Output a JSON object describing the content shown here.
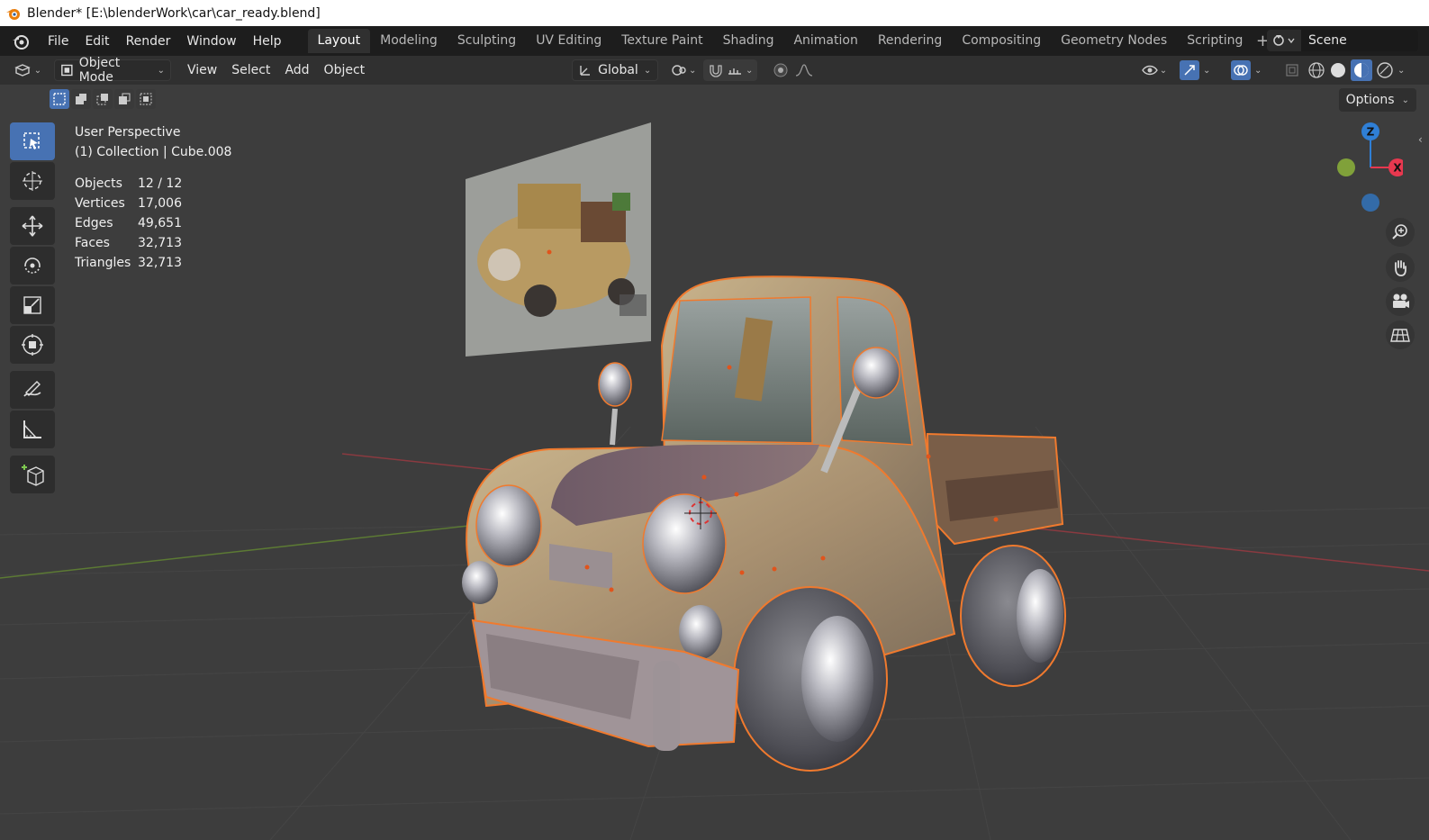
{
  "window": {
    "title": "Blender* [E:\\blenderWork\\car\\car_ready.blend]"
  },
  "menu": {
    "file": "File",
    "edit": "Edit",
    "render": "Render",
    "window": "Window",
    "help": "Help"
  },
  "workspaces": [
    "Layout",
    "Modeling",
    "Sculpting",
    "UV Editing",
    "Texture Paint",
    "Shading",
    "Animation",
    "Rendering",
    "Compositing",
    "Geometry Nodes",
    "Scripting"
  ],
  "active_workspace": "Layout",
  "scene": {
    "name": "Scene"
  },
  "header": {
    "mode": "Object Mode",
    "view": "View",
    "select": "Select",
    "add": "Add",
    "object": "Object",
    "transform_orientation": "Global",
    "options": "Options"
  },
  "viewport": {
    "perspective": "User Perspective",
    "collection": "(1) Collection | Cube.008"
  },
  "stats": [
    {
      "label": "Objects",
      "value": "12 / 12"
    },
    {
      "label": "Vertices",
      "value": "17,006"
    },
    {
      "label": "Edges",
      "value": "49,651"
    },
    {
      "label": "Faces",
      "value": "32,713"
    },
    {
      "label": "Triangles",
      "value": "32,713"
    }
  ],
  "gizmo": {
    "z": "Z",
    "x": "X"
  },
  "colors": {
    "selection_outline": "#f07a2e",
    "active_tool": "#4772b3",
    "axis_x": "#e8384f",
    "axis_y": "#8cb33a",
    "axis_z": "#2f7fd6"
  },
  "icons": [
    "blender-logo-icon",
    "select-box-icon",
    "cursor-icon",
    "move-icon",
    "rotate-icon",
    "scale-icon",
    "transform-icon",
    "annotate-icon",
    "measure-icon",
    "add-cube-icon",
    "zoom-icon",
    "pan-hand-icon",
    "camera-icon",
    "grid-view-icon"
  ]
}
